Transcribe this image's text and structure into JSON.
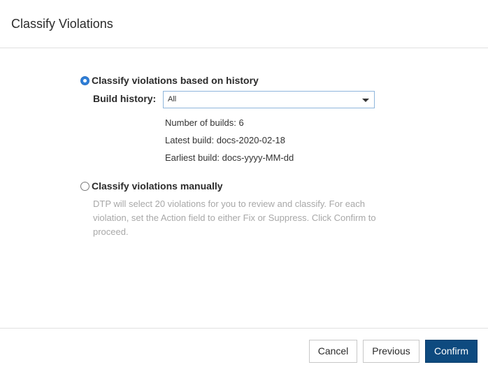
{
  "dialog": {
    "title": "Classify Violations"
  },
  "option_history": {
    "label": "Classify violations based on history",
    "selected": true,
    "build_history_label": "Build history:",
    "build_history_value": "All",
    "info": {
      "number_of_builds": "Number of builds: 6",
      "latest_build": "Latest build: docs-2020-02-18",
      "earliest_build": "Earliest build: docs-yyyy-MM-dd"
    }
  },
  "option_manual": {
    "label": "Classify violations manually",
    "selected": false,
    "description": "DTP will select 20 violations for you to review and classify. For each violation, set the Action field to either Fix or Suppress. Click Confirm to proceed."
  },
  "footer": {
    "cancel_label": "Cancel",
    "previous_label": "Previous",
    "confirm_label": "Confirm"
  }
}
